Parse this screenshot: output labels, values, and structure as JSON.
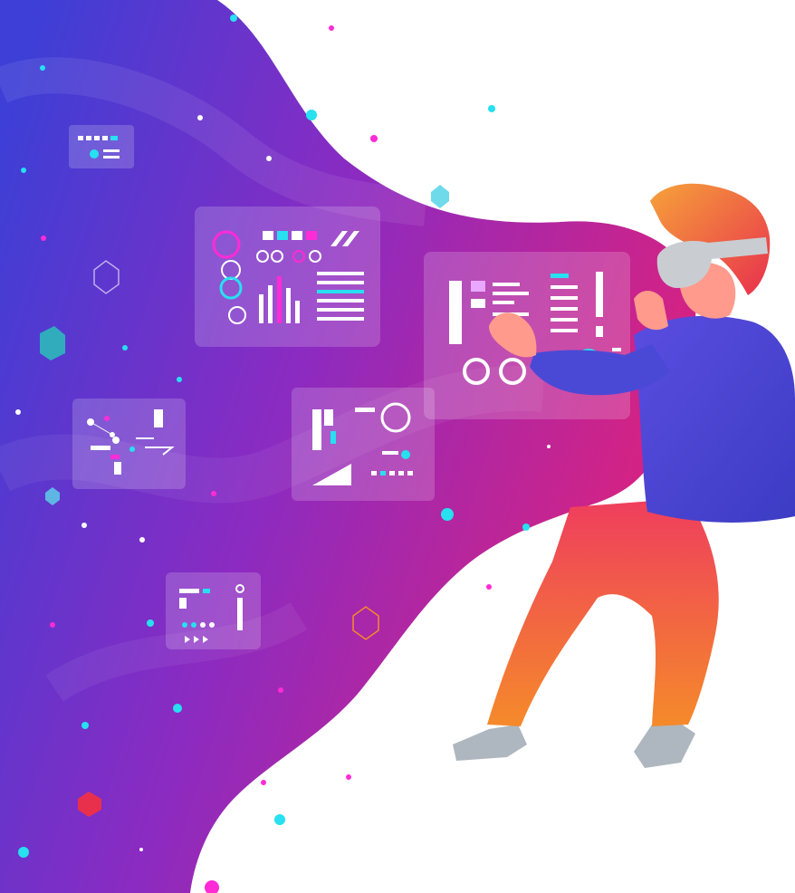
{
  "illustration": {
    "subject": "",
    "colors": {
      "background": "#ffffff",
      "gradient_left": "#3d3fd6",
      "gradient_mid": "#8a2bc2",
      "gradient_right": "#e0217a",
      "accent_cyan": "#27e0f0",
      "accent_magenta": "#ff2bd6",
      "panel_fill": "#ffffff",
      "shirt": "#4a49d6",
      "pants_top": "#ef3d5e",
      "pants_bottom": "#f58a2a",
      "hair": "#f2552f",
      "skin": "#ff9a8c",
      "shoes": "#aeb7bf",
      "headset": "#c9cdd2",
      "corner_tab": "#27e0f0"
    }
  }
}
